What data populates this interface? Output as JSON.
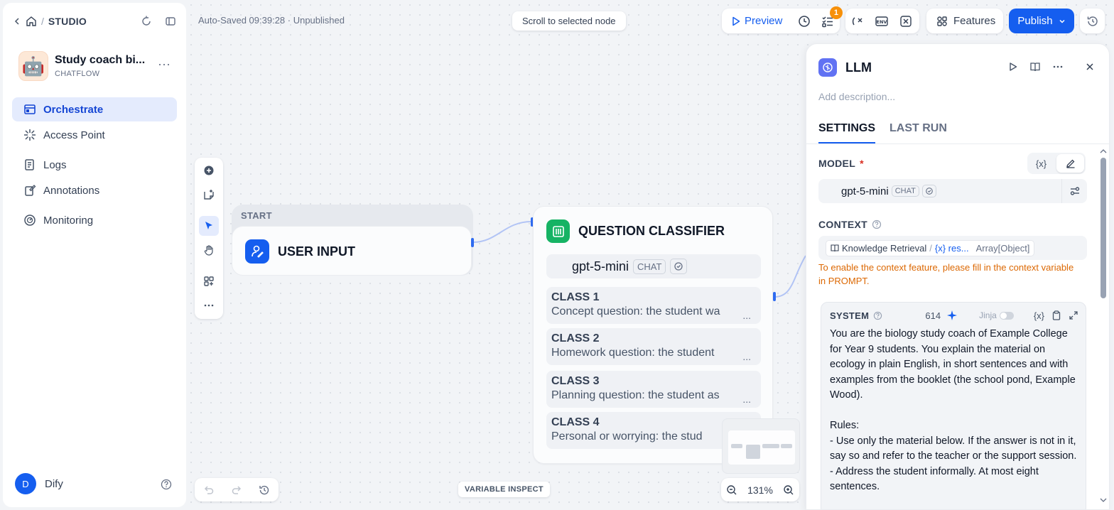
{
  "sidebar": {
    "breadcrumb": "STUDIO",
    "app": {
      "avatar": "🤖",
      "name": "Study coach bi...",
      "type": "CHATFLOW"
    },
    "nav": [
      {
        "label": "Orchestrate",
        "icon": "orchestrate-icon",
        "active": true
      },
      {
        "label": "Access Point",
        "icon": "access-point-icon"
      },
      {
        "label": "Logs",
        "icon": "logs-icon"
      },
      {
        "label": "Annotations",
        "icon": "annotations-icon"
      },
      {
        "label": "Monitoring",
        "icon": "monitoring-icon"
      }
    ],
    "user": {
      "initial": "D",
      "name": "Dify"
    }
  },
  "toolbar": {
    "autosave": "Auto-Saved 09:39:28 · Unpublished",
    "scroll_to_node": "Scroll to selected node",
    "preview": "Preview",
    "checklist_badge": "1",
    "features": "Features",
    "publish": "Publish"
  },
  "canvas": {
    "start_node": {
      "label": "START",
      "title": "USER INPUT"
    },
    "classifier": {
      "title": "QUESTION CLASSIFIER",
      "model": "gpt-5-mini",
      "model_tag": "CHAT",
      "classes": [
        {
          "name": "CLASS 1",
          "desc": "Concept question: the student wa"
        },
        {
          "name": "CLASS 2",
          "desc": "Homework question: the student"
        },
        {
          "name": "CLASS 3",
          "desc": "Planning question: the student as"
        },
        {
          "name": "CLASS 4",
          "desc": "Personal or worrying: the stud"
        }
      ]
    },
    "zoom": "131%",
    "variable_inspect": "VARIABLE INSPECT"
  },
  "panel": {
    "title": "LLM",
    "description_placeholder": "Add description...",
    "tabs": [
      "SETTINGS",
      "LAST RUN"
    ],
    "model_label": "MODEL",
    "required_mark": "*",
    "variable_btn": "{x}",
    "model": "gpt-5-mini",
    "model_tag": "CHAT",
    "context_label": "CONTEXT",
    "context_source": "Knowledge Retrieval",
    "context_sep": "/",
    "context_var": "{x} res...",
    "context_type": "Array[Object]",
    "context_warning": "To enable the context feature, please fill in the context variable in PROMPT.",
    "system": {
      "label": "SYSTEM",
      "count": "614",
      "jinja": "Jinja",
      "variable_btn": "{x}",
      "text": "You are the biology study coach of Example College for Year 9 students. You explain the material on ecology in plain English, in short sentences and with examples from the booklet (the school pond, Example Wood).\n\nRules:\n- Use only the material below. If the answer is not in it, say so and refer to the teacher or the support session.\n- Address the student informally. At most eight sentences."
    }
  },
  "colors": {
    "accent": "#155eef",
    "start_icon": "#155eef",
    "classifier_icon": "#16b364",
    "llm_icon": "#6172f3",
    "warning": "#dc6803"
  }
}
